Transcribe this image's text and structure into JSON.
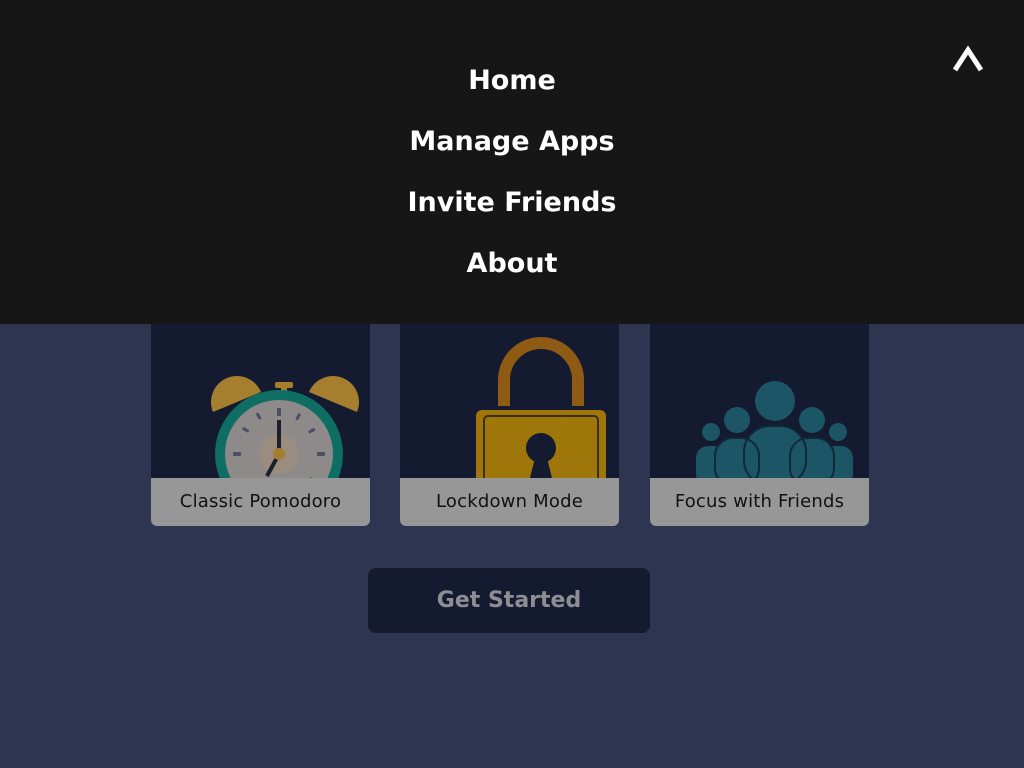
{
  "menu": {
    "items": [
      {
        "label": "Home"
      },
      {
        "label": "Manage Apps"
      },
      {
        "label": "Invite Friends"
      },
      {
        "label": "About"
      }
    ],
    "collapse_icon": "chevron-up-icon"
  },
  "cards": [
    {
      "label": "Classic Pomodoro",
      "icon": "alarm-clock-icon"
    },
    {
      "label": "Lockdown Mode",
      "icon": "padlock-icon"
    },
    {
      "label": "Focus with Friends",
      "icon": "group-people-icon"
    }
  ],
  "actions": {
    "get_started_label": "Get Started"
  },
  "colors": {
    "menu_background": "#161616",
    "page_background": "#2e3550",
    "card_background": "#141a30",
    "card_label_background": "#979797",
    "button_text": "#8e8e92"
  }
}
